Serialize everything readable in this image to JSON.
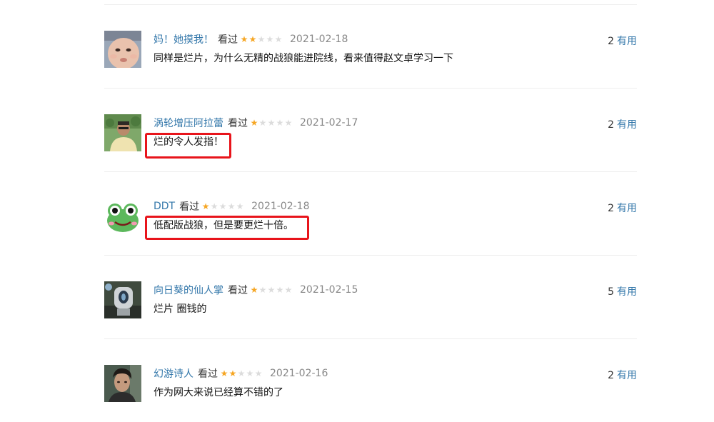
{
  "comments": [
    {
      "user": "妈！她摸我！",
      "status": "看过",
      "rating": 2,
      "date": "2021-02-18",
      "text": "同样是烂片，为什么无精的战狼能进院线，看来值得赵文卓学习一下",
      "votes": "2",
      "useful_label": "有用",
      "avatar": "baby-face",
      "highlighted": false
    },
    {
      "user": "涡轮增压阿拉蕾",
      "status": "看过",
      "rating": 1,
      "date": "2021-02-17",
      "text": "烂的令人发指！",
      "votes": "2",
      "useful_label": "有用",
      "avatar": "man-outdoor",
      "highlighted": true
    },
    {
      "user": "DDT",
      "status": "看过",
      "rating": 1,
      "date": "2021-02-18",
      "text": "低配版战狼，但是要更烂十倍。",
      "votes": "2",
      "useful_label": "有用",
      "avatar": "green-frog",
      "highlighted": true
    },
    {
      "user": "向日葵的仙人掌",
      "status": "看过",
      "rating": 1,
      "date": "2021-02-15",
      "text": "烂片 圈钱的",
      "votes": "5",
      "useful_label": "有用",
      "avatar": "robot-toy",
      "highlighted": false
    },
    {
      "user": "幻游诗人",
      "status": "看过",
      "rating": 2,
      "date": "2021-02-16",
      "text": "作为网大来说已经算不错的了",
      "votes": "2",
      "useful_label": "有用",
      "avatar": "young-man",
      "highlighted": false
    }
  ],
  "colors": {
    "link": "#3377aa",
    "star_on": "#f6a623",
    "star_off": "#dcdcdc",
    "highlight_border": "#e8141b"
  }
}
